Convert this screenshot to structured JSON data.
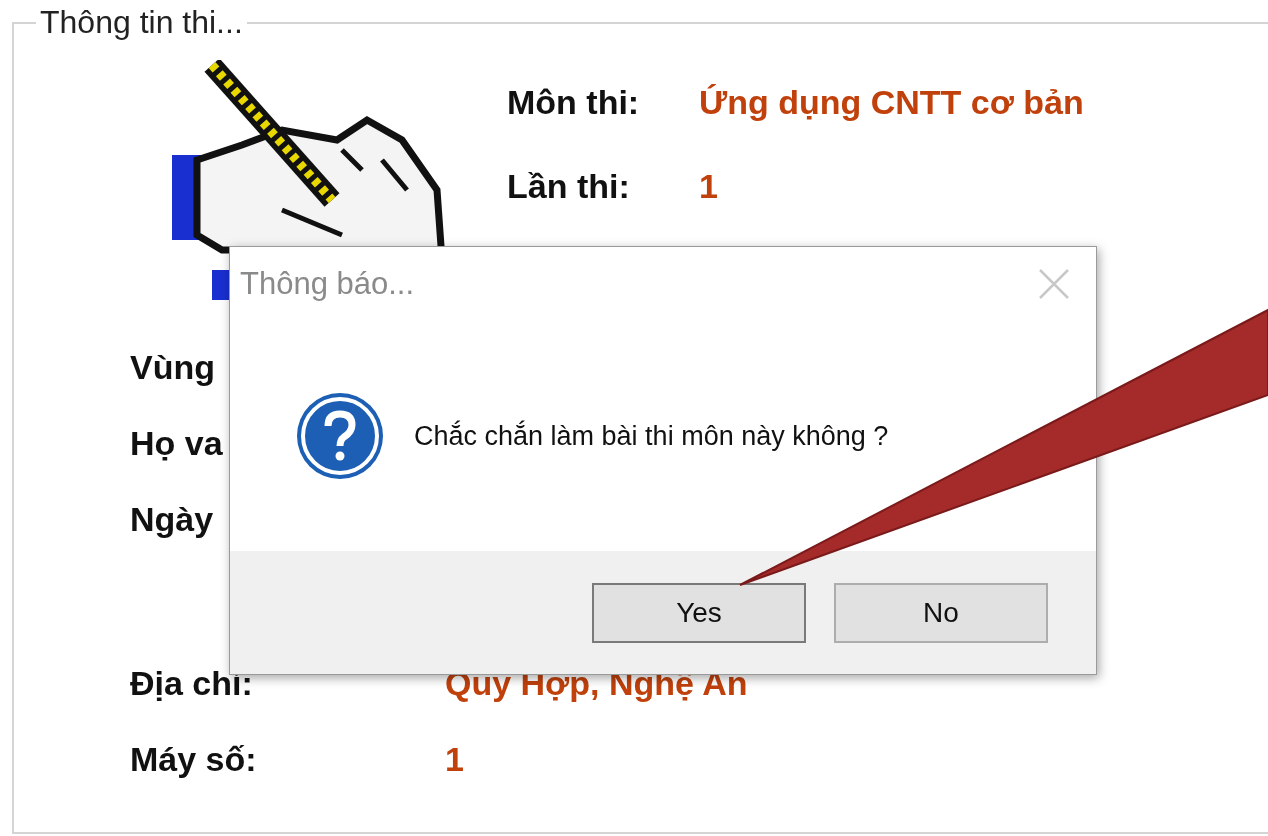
{
  "group": {
    "title": "Thông tin thi..."
  },
  "exam": [
    {
      "label": "Môn thi:",
      "value": "Ứng dụng CNTT cơ bản"
    },
    {
      "label": "Lần thi:",
      "value": "1"
    }
  ],
  "details": [
    {
      "label": "Vùng"
    },
    {
      "label": "Họ va"
    },
    {
      "label": "Ngày"
    },
    {
      "label": "Địa chỉ:",
      "value": "Quy Hợp, Nghệ An"
    },
    {
      "label": "Máy số:",
      "value": "1"
    }
  ],
  "dialog": {
    "title": "Thông báo...",
    "message": "Chắc chắn làm bài thi môn này không ?",
    "buttons": [
      {
        "label": "Yes",
        "selected": true
      },
      {
        "label": "No",
        "selected": false
      }
    ]
  }
}
